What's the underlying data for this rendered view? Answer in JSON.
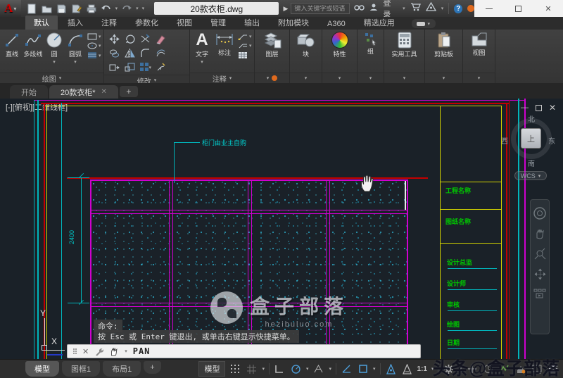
{
  "titlebar": {
    "logo": "A",
    "filename": "20款衣柜.dwg",
    "search_placeholder": "键入关键字或短语",
    "signin": "登录"
  },
  "ribbon": {
    "tabs": [
      "默认",
      "插入",
      "注释",
      "参数化",
      "视图",
      "管理",
      "输出",
      "附加模块",
      "A360",
      "精选应用"
    ],
    "active_tab": "默认",
    "draw": {
      "label": "绘图",
      "line": "直线",
      "polyline": "多段线",
      "circle": "圆",
      "arc": "圆弧"
    },
    "modify": {
      "label": "修改"
    },
    "annotate": {
      "label": "注释",
      "text": "文字",
      "dim": "标注"
    },
    "layers": {
      "label": "图层"
    },
    "block": {
      "label": "块"
    },
    "properties": {
      "label": "特性"
    },
    "groups": {
      "label": "组"
    },
    "utilities": {
      "label": "实用工具"
    },
    "clipboard": {
      "label": "剪贴板"
    },
    "view": {
      "label": "视图"
    }
  },
  "file_tabs": {
    "start": "开始",
    "drawing": "20款衣柜*"
  },
  "canvas": {
    "viewport_label": "[-][俯视][二维线框]",
    "leader_text": "柜门由业主自购",
    "dimension": "2400",
    "viewcube": {
      "n": "北",
      "e": "东",
      "s": "南",
      "w": "西",
      "top": "上",
      "wcs": "WCS"
    },
    "titleblock": {
      "project": "工程名称",
      "sheet": "图纸名称",
      "rows": [
        "设计总监",
        "设计师",
        "审核",
        "绘图",
        "日期"
      ]
    },
    "watermark_title": "盒子部落",
    "watermark_url": "hezibuluo.com"
  },
  "command": {
    "prompt": "命令:",
    "history": "按 Esc 或 Enter 键退出, 或单击右键显示快捷菜单。",
    "current": "PAN"
  },
  "statusbar": {
    "tabs": [
      "模型",
      "图框1",
      "布局1"
    ],
    "model": "模型",
    "scale": "1:1",
    "watermark": "头条@盒子部落"
  },
  "colors": {
    "canvas_bg": "#1a2128",
    "cabinet": "#cf00cf",
    "hatch": "#2cb0cd",
    "frame_yellow": "#d4d400",
    "frame_red": "#c40000",
    "annotation_cyan": "#00c8c8",
    "titleblock_green": "#00c800",
    "accent_orange": "#e06a1e",
    "osnap_blue": "#4ea0dc"
  }
}
